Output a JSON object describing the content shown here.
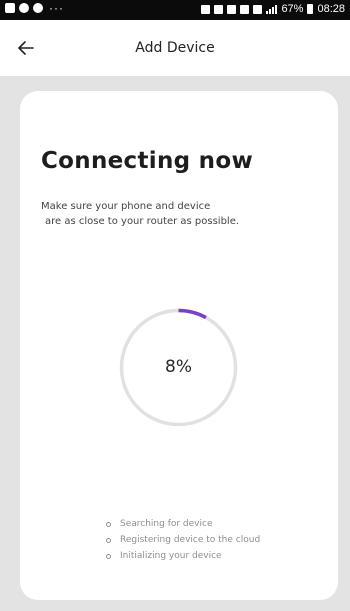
{
  "status_bar": {
    "battery_text": "67%",
    "time": "08:28",
    "overflow_dots": "···"
  },
  "header": {
    "title": "Add Device"
  },
  "card": {
    "title": "Connecting now",
    "instruction_line1": "Make sure your phone and device",
    "instruction_line2": "are as close to your router as possible.",
    "progress_label": "8%",
    "progress_fraction": 0.08,
    "steps": [
      "Searching for device",
      "Registering device to the cloud",
      "Initializing your device"
    ]
  },
  "colors": {
    "accent": "#7a3fc4",
    "ring_track": "#e1e1e1",
    "background": "#e3e3e3",
    "card": "#ffffff",
    "status_bar": "#0b0b0b"
  },
  "icons": {
    "back": "arrow-left-icon"
  }
}
